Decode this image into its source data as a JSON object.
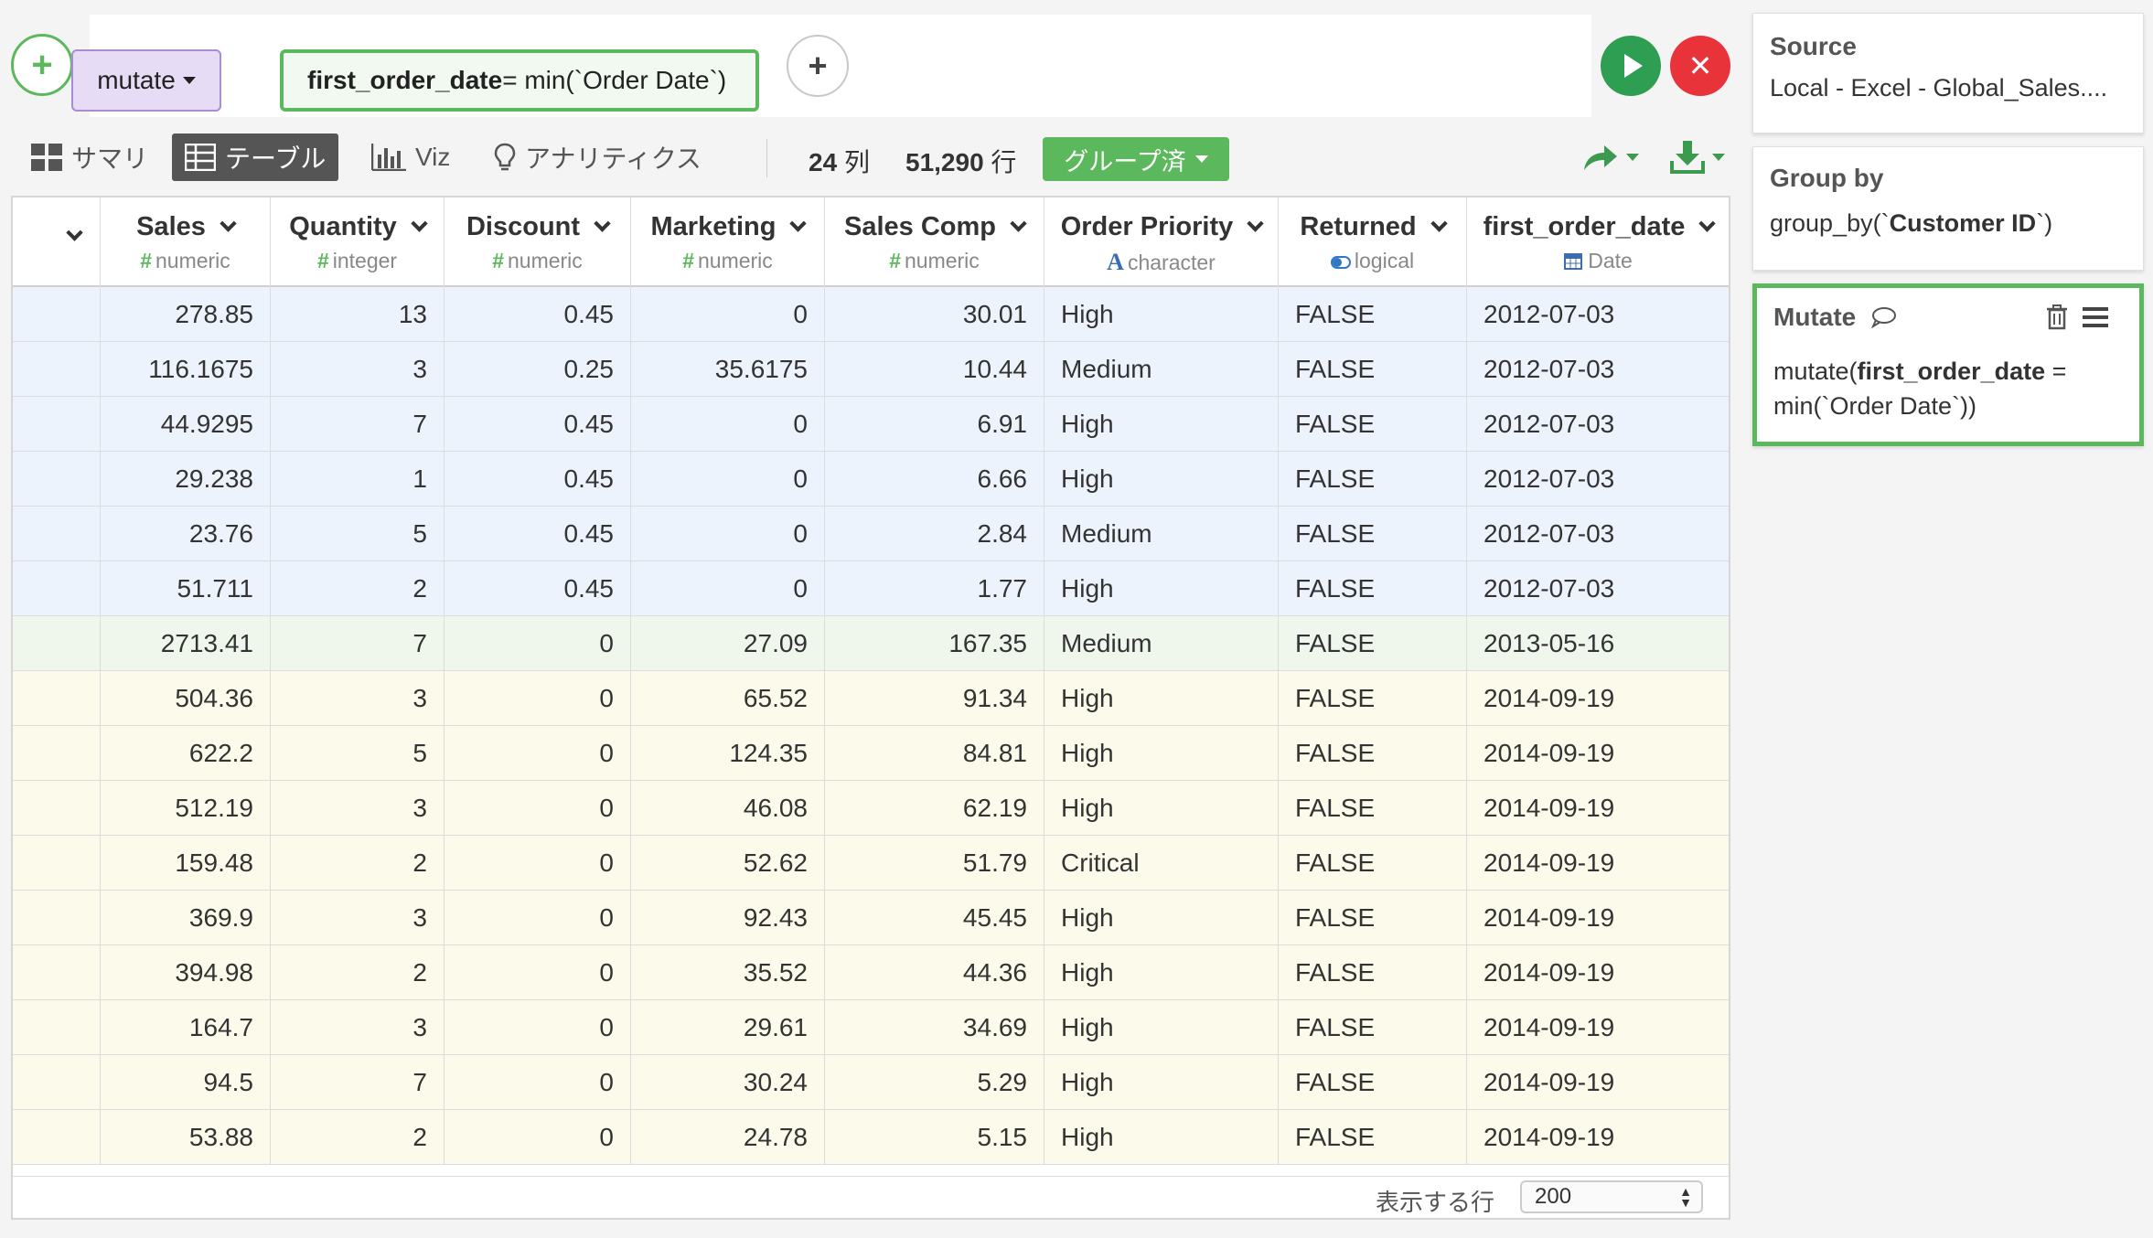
{
  "command": {
    "verb": "mutate",
    "expression_new_col": "first_order_date",
    "expression_rest": " = min(`Order Date`)"
  },
  "tabs": {
    "summary": "サマリ",
    "table": "テーブル",
    "viz": "Viz",
    "analytics": "アナリティクス"
  },
  "counts": {
    "cols_num": "24",
    "cols_unit": "列",
    "rows_num": "51,290",
    "rows_unit": "行"
  },
  "grouped_label": "グループ済",
  "columns": [
    {
      "name": "Sales",
      "type": "numeric",
      "icon": "#"
    },
    {
      "name": "Quantity",
      "type": "integer",
      "icon": "#"
    },
    {
      "name": "Discount",
      "type": "numeric",
      "icon": "#"
    },
    {
      "name": "Marketing",
      "type": "numeric",
      "icon": "#"
    },
    {
      "name": "Sales Comp",
      "type": "numeric",
      "icon": "#"
    },
    {
      "name": "Order Priority",
      "type": "character",
      "icon": "A"
    },
    {
      "name": "Returned",
      "type": "logical",
      "icon": "toggle"
    },
    {
      "name": "first_order_date",
      "type": "Date",
      "icon": "calendar"
    }
  ],
  "rows": [
    [
      "278.85",
      "13",
      "0.45",
      "0",
      "30.01",
      "High",
      "FALSE",
      "2012-07-03"
    ],
    [
      "116.1675",
      "3",
      "0.25",
      "35.6175",
      "10.44",
      "Medium",
      "FALSE",
      "2012-07-03"
    ],
    [
      "44.9295",
      "7",
      "0.45",
      "0",
      "6.91",
      "High",
      "FALSE",
      "2012-07-03"
    ],
    [
      "29.238",
      "1",
      "0.45",
      "0",
      "6.66",
      "High",
      "FALSE",
      "2012-07-03"
    ],
    [
      "23.76",
      "5",
      "0.45",
      "0",
      "2.84",
      "Medium",
      "FALSE",
      "2012-07-03"
    ],
    [
      "51.711",
      "2",
      "0.45",
      "0",
      "1.77",
      "High",
      "FALSE",
      "2012-07-03"
    ],
    [
      "2713.41",
      "7",
      "0",
      "27.09",
      "167.35",
      "Medium",
      "FALSE",
      "2013-05-16"
    ],
    [
      "504.36",
      "3",
      "0",
      "65.52",
      "91.34",
      "High",
      "FALSE",
      "2014-09-19"
    ],
    [
      "622.2",
      "5",
      "0",
      "124.35",
      "84.81",
      "High",
      "FALSE",
      "2014-09-19"
    ],
    [
      "512.19",
      "3",
      "0",
      "46.08",
      "62.19",
      "High",
      "FALSE",
      "2014-09-19"
    ],
    [
      "159.48",
      "2",
      "0",
      "52.62",
      "51.79",
      "Critical",
      "FALSE",
      "2014-09-19"
    ],
    [
      "369.9",
      "3",
      "0",
      "92.43",
      "45.45",
      "High",
      "FALSE",
      "2014-09-19"
    ],
    [
      "394.98",
      "2",
      "0",
      "35.52",
      "44.36",
      "High",
      "FALSE",
      "2014-09-19"
    ],
    [
      "164.7",
      "3",
      "0",
      "29.61",
      "34.69",
      "High",
      "FALSE",
      "2014-09-19"
    ],
    [
      "94.5",
      "7",
      "0",
      "30.24",
      "5.29",
      "High",
      "FALSE",
      "2014-09-19"
    ],
    [
      "53.88",
      "2",
      "0",
      "24.78",
      "5.15",
      "High",
      "FALSE",
      "2014-09-19"
    ]
  ],
  "row_groups": [
    0,
    0,
    0,
    0,
    0,
    0,
    1,
    2,
    2,
    2,
    2,
    2,
    2,
    2,
    2,
    2
  ],
  "group_colors": [
    "#edf3fc",
    "#eff6ec",
    "#fcfbeb"
  ],
  "footer": {
    "rows_label": "表示する行",
    "rows_value": "200"
  },
  "pipeline": {
    "source_title": "Source",
    "source_value": "Local - Excel - Global_Sales....",
    "groupby_title": "Group by",
    "groupby_prefix": "group_by(`",
    "groupby_col": "Customer ID",
    "groupby_suffix": "`)",
    "mutate_title": "Mutate",
    "mutate_prefix": "mutate(",
    "mutate_col": "first_order_date",
    "mutate_rest": " = min(`Order Date`))"
  },
  "colors": {
    "accent_green": "#5cb85c",
    "run_green": "#2e9e52",
    "cancel_red": "#e8333b",
    "verb_purple": "#e6dcf5",
    "numeric_icon": "#5cb85c",
    "character_icon": "#3b6db5",
    "logical_icon": "#2f78c4",
    "date_icon": "#3b6db5"
  },
  "icons": {
    "add_step": "plus-icon",
    "run": "play-icon",
    "cancel": "close-icon",
    "share": "share-arrow-icon",
    "download": "download-icon"
  }
}
